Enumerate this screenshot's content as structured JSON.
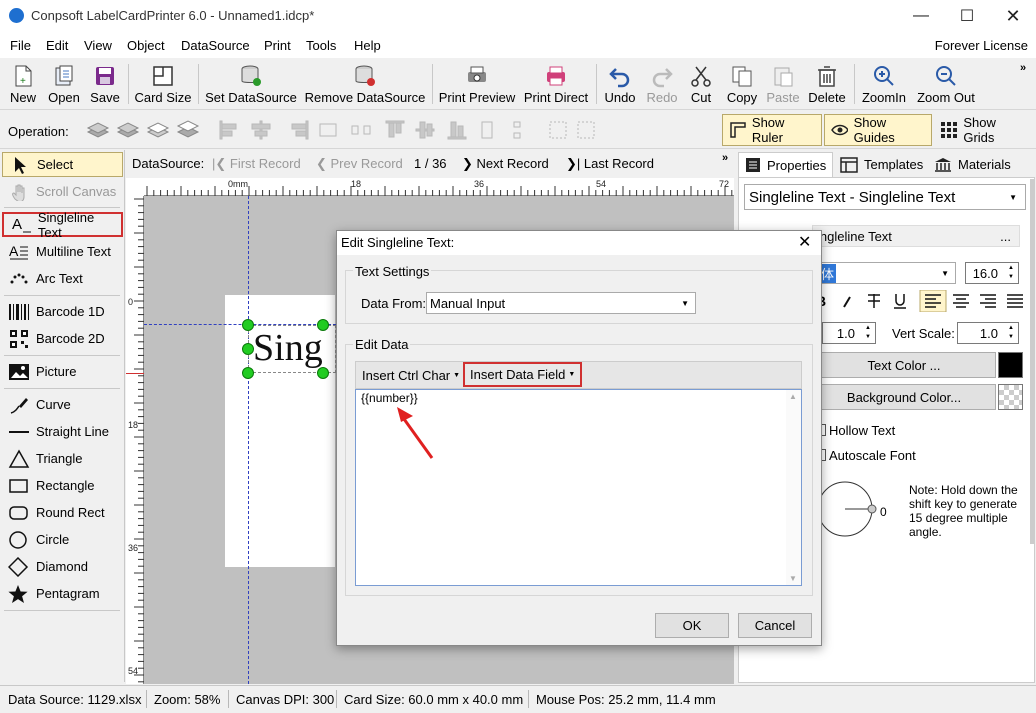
{
  "window": {
    "title": "Conpsoft LabelCardPrinter 6.0 - Unnamed1.idcp*"
  },
  "menu": {
    "items": [
      "File",
      "Edit",
      "View",
      "Object",
      "DataSource",
      "Print",
      "Tools",
      "Help"
    ],
    "license": "Forever License"
  },
  "toolbar": {
    "new": "New",
    "open": "Open",
    "save": "Save",
    "card_size": "Card Size",
    "set_ds": "Set DataSource",
    "remove_ds": "Remove DataSource",
    "print_preview": "Print Preview",
    "print_direct": "Print Direct",
    "undo": "Undo",
    "redo": "Redo",
    "cut": "Cut",
    "copy": "Copy",
    "paste": "Paste",
    "delete": "Delete",
    "zoom_in": "ZoomIn",
    "zoom_out": "Zoom Out"
  },
  "operation": {
    "label": "Operation:",
    "show_ruler": "Show Ruler",
    "show_guides": "Show Guides",
    "show_grids": "Show Grids"
  },
  "tools": {
    "select": "Select",
    "scroll_canvas": "Scroll Canvas",
    "singleline_text": "Singleline Text",
    "multiline_text": "Multiline Text",
    "arc_text": "Arc Text",
    "barcode_1d": "Barcode 1D",
    "barcode_2d": "Barcode 2D",
    "picture": "Picture",
    "curve": "Curve",
    "straight_line": "Straight Line",
    "triangle": "Triangle",
    "rectangle": "Rectangle",
    "round_rect": "Round Rect",
    "circle": "Circle",
    "diamond": "Diamond",
    "pentagram": "Pentagram"
  },
  "datasource_bar": {
    "label": "DataSource:",
    "first": "First Record",
    "prev": "Prev Record",
    "counter": "1 / 36",
    "next": "Next Record",
    "last": "Last Record"
  },
  "ruler": {
    "h": [
      "0mm",
      "18",
      "36",
      "54",
      "72"
    ],
    "v": [
      "0",
      "18",
      "36",
      "54"
    ]
  },
  "canvas": {
    "text": "Sing"
  },
  "dialog": {
    "title": "Edit Singleline Text:",
    "group_text_settings": "Text Settings",
    "data_from_label": "Data From:",
    "data_from_value": "Manual Input",
    "group_edit_data": "Edit Data",
    "insert_ctrl_char": "Insert Ctrl Char",
    "insert_data_field": "Insert Data Field",
    "content": "{{number}}",
    "ok": "OK",
    "cancel": "Cancel"
  },
  "panel": {
    "tab_properties": "Properties",
    "tab_templates": "Templates",
    "tab_materials": "Materials",
    "object_select": "Singleline Text - Singleline Text",
    "name_value": "ingleline Text",
    "font_value": "体",
    "font_size": "16.0",
    "hscale_value": "1.0",
    "vscale_label": "Vert Scale:",
    "vscale_value": "1.0",
    "text_color": "Text Color ...",
    "bg_color": "Background Color...",
    "hollow_text": "Hollow Text",
    "autoscale_font": "Autoscale Font",
    "angle_value": "0",
    "note": "Note: Hold down the shift key to generate 15 degree multiple angle.",
    "text_color_hex": "#000000"
  },
  "status": {
    "data_source": "Data Source: 1129.xlsx",
    "zoom": "Zoom: 58%",
    "dpi": "Canvas DPI: 300",
    "card_size": "Card Size: 60.0 mm x 40.0 mm",
    "mouse_pos": "Mouse Pos: 25.2 mm, 11.4 mm"
  }
}
